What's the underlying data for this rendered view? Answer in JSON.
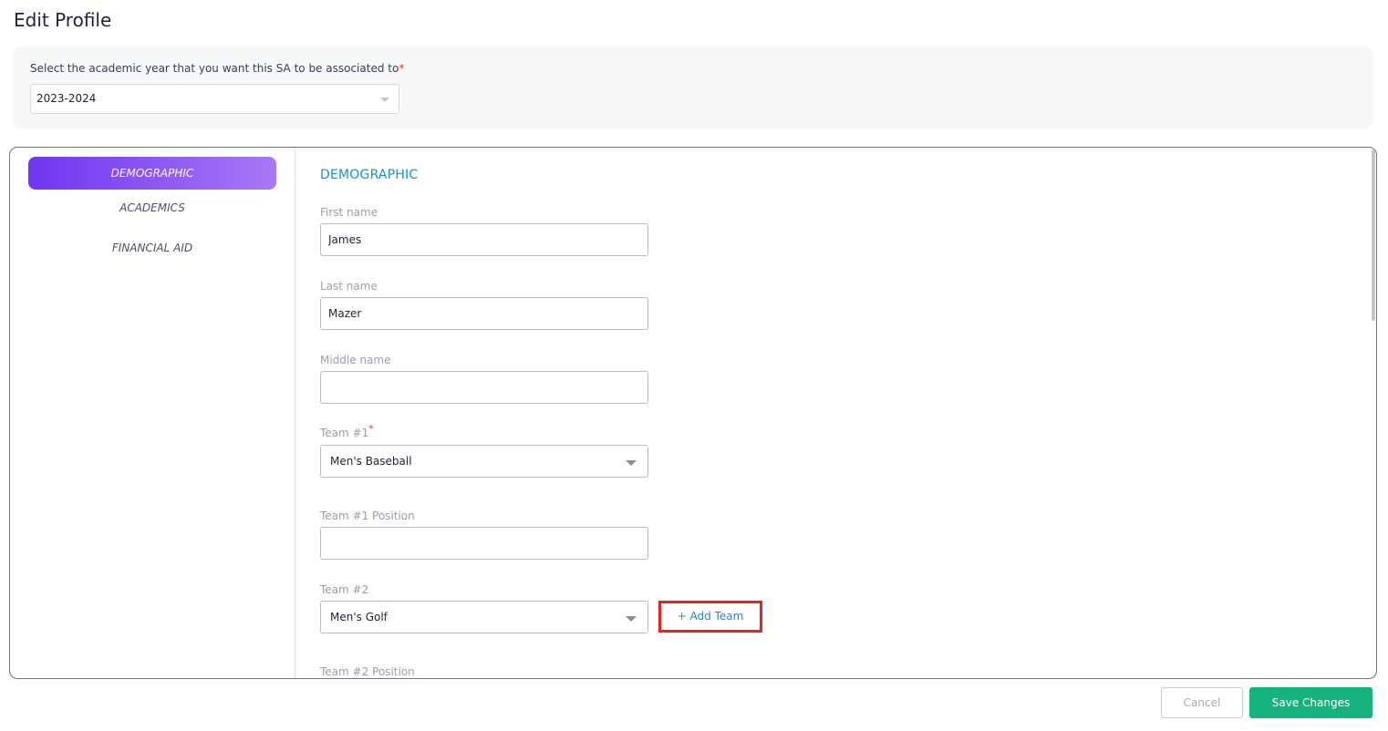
{
  "page": {
    "title": "Edit Profile"
  },
  "academic_year": {
    "label": "Select the academic year that you want this SA to be associated to",
    "required_mark": "*",
    "selected": "2023-2024"
  },
  "sidebar": {
    "items": [
      {
        "label": "DEMOGRAPHIC",
        "active": true
      },
      {
        "label": "ACADEMICS",
        "active": false
      },
      {
        "label": "FINANCIAL AID",
        "active": false
      }
    ]
  },
  "form": {
    "section_title": "DEMOGRAPHIC",
    "first_name": {
      "label": "First name",
      "value": "James"
    },
    "last_name": {
      "label": "Last name",
      "value": "Mazer"
    },
    "middle_name": {
      "label": "Middle name",
      "value": ""
    },
    "team1": {
      "label": "Team #1",
      "required_mark": "*",
      "value": "Men's Baseball"
    },
    "team1_position": {
      "label": "Team #1 Position",
      "value": ""
    },
    "team2": {
      "label": "Team #2",
      "value": "Men's Golf"
    },
    "add_team_label": "+ Add Team",
    "team2_position": {
      "label": "Team #2 Position"
    }
  },
  "actions": {
    "cancel_label": "Cancel",
    "save_label": "Save Changes"
  },
  "colors": {
    "accent_gradient_start": "#6e36f0",
    "accent_gradient_end": "#a879f5",
    "link_blue": "#1a8ed1",
    "save_green": "#14b37e",
    "required_red": "#e53935",
    "highlight_red": "#e8231c"
  }
}
